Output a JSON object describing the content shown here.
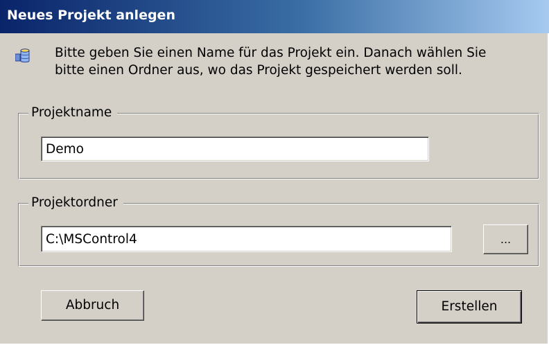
{
  "window": {
    "title": "Neues Projekt anlegen"
  },
  "info": {
    "icon": "database-icon",
    "text": "Bitte geben Sie einen Name für das Projekt ein. Danach wählen Sie\nbitte einen Ordner aus, wo das Projekt gespeichert werden soll."
  },
  "project_name": {
    "label": "Projektname",
    "value": "Demo"
  },
  "project_folder": {
    "label": "Projektordner",
    "value": "C:\\MSControl4",
    "browse_label": "..."
  },
  "buttons": {
    "cancel_label": "Abbruch",
    "create_label": "Erstellen"
  },
  "colors": {
    "dialog_background": "#d4d0c8",
    "titlebar_start": "#0a246a",
    "titlebar_end": "#a6caf0"
  }
}
